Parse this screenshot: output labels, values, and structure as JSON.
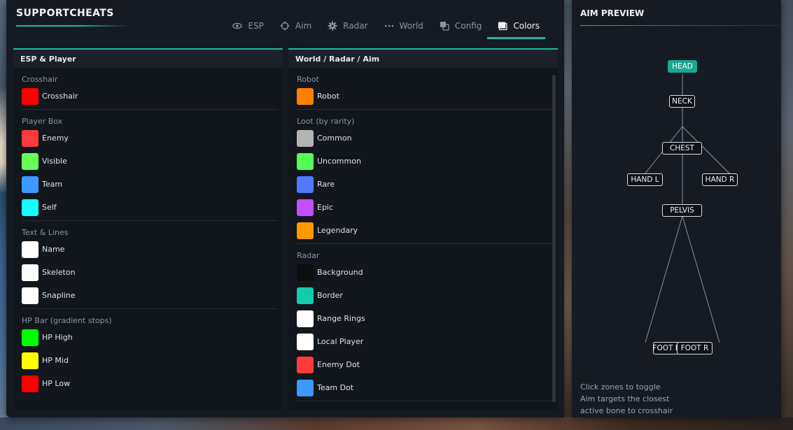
{
  "brand": "SUPPORTCHEATS",
  "tabs": [
    {
      "label": "ESP",
      "icon": "eye-icon"
    },
    {
      "label": "Aim",
      "icon": "crosshair-icon"
    },
    {
      "label": "Radar",
      "icon": "gear-icon"
    },
    {
      "label": "World",
      "icon": "dots-icon"
    },
    {
      "label": "Config",
      "icon": "copy-icon"
    },
    {
      "label": "Colors",
      "icon": "palette-icon",
      "active": true
    }
  ],
  "left_section": {
    "title": "ESP & Player",
    "groups": [
      {
        "title": "Crosshair",
        "items": [
          {
            "label": "Crosshair",
            "color": "#ff0000"
          }
        ]
      },
      {
        "title": "Player Box",
        "items": [
          {
            "label": "Enemy",
            "color": "#ff3b3b"
          },
          {
            "label": "Visible",
            "color": "#66ff55"
          },
          {
            "label": "Team",
            "color": "#3b99ff"
          },
          {
            "label": "Self",
            "color": "#13ffff"
          }
        ]
      },
      {
        "title": "Text & Lines",
        "items": [
          {
            "label": "Name",
            "color": "#ffffff"
          },
          {
            "label": "Skeleton",
            "color": "#ffffff"
          },
          {
            "label": "Snapline",
            "color": "#ffffff"
          }
        ]
      },
      {
        "title": "HP Bar (gradient stops)",
        "items": [
          {
            "label": "HP High",
            "color": "#00ff00"
          },
          {
            "label": "HP Mid",
            "color": "#ffff00"
          },
          {
            "label": "HP Low",
            "color": "#ff0000"
          }
        ]
      }
    ]
  },
  "right_section": {
    "title": "World / Radar / Aim",
    "groups": [
      {
        "title": "Robot",
        "items": [
          {
            "label": "Robot",
            "color": "#ff8000"
          }
        ]
      },
      {
        "title": "Loot (by rarity)",
        "items": [
          {
            "label": "Common",
            "color": "#b3b3b3"
          },
          {
            "label": "Uncommon",
            "color": "#55ff55"
          },
          {
            "label": "Rare",
            "color": "#4d7aff"
          },
          {
            "label": "Epic",
            "color": "#c34dff"
          },
          {
            "label": "Legendary",
            "color": "#ff9900"
          }
        ]
      },
      {
        "title": "Radar",
        "items": [
          {
            "label": "Background",
            "color": "#0d0d0d"
          },
          {
            "label": "Border",
            "color": "#13ccaa"
          },
          {
            "label": "Range Rings",
            "color": "#ffffff"
          },
          {
            "label": "Local Player",
            "color": "#ffffff"
          },
          {
            "label": "Enemy Dot",
            "color": "#ff3b3b"
          },
          {
            "label": "Team Dot",
            "color": "#3b99ff"
          }
        ]
      }
    ]
  },
  "aim_preview": {
    "title": "AIM PREVIEW",
    "bones": [
      {
        "id": "head",
        "label": "HEAD",
        "active": true
      },
      {
        "id": "neck",
        "label": "NECK",
        "active": false
      },
      {
        "id": "chest",
        "label": "CHEST",
        "active": false
      },
      {
        "id": "hand_l",
        "label": "HAND L",
        "active": false
      },
      {
        "id": "hand_r",
        "label": "HAND R",
        "active": false
      },
      {
        "id": "pelvis",
        "label": "PELVIS",
        "active": false
      },
      {
        "id": "foot_l",
        "label": "FOOT L",
        "active": false
      },
      {
        "id": "foot_r",
        "label": "FOOT R",
        "active": false
      }
    ],
    "hint_lines": [
      "Click zones to toggle",
      "Aim targets the closest",
      "active bone to crosshair"
    ],
    "accent": "#1fb8a0"
  }
}
